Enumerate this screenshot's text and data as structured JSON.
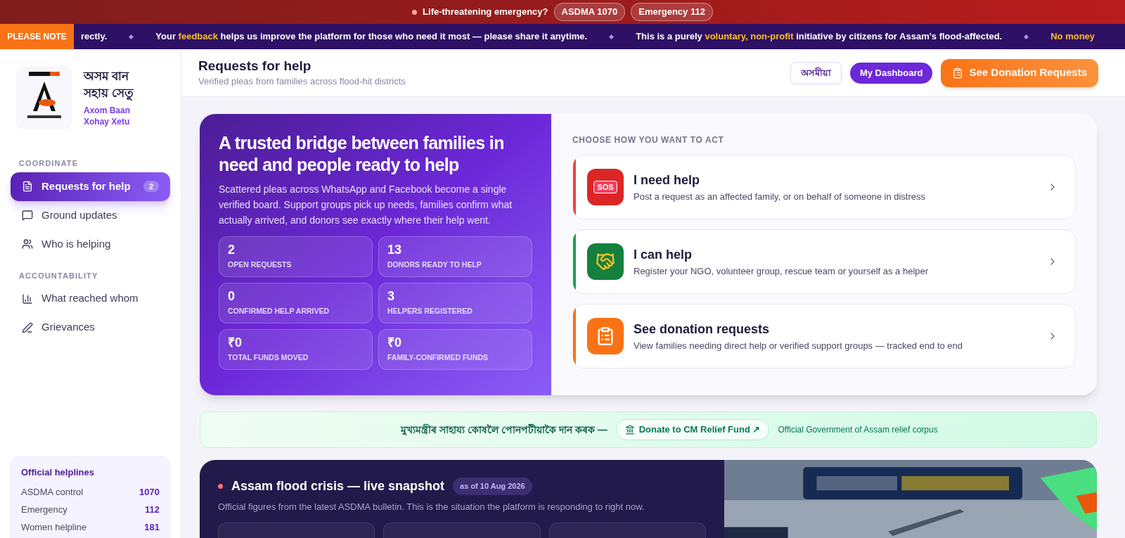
{
  "alert_bar": {
    "text": "Life-threatening emergency?",
    "pills": [
      "ASDMA 1070",
      "Emergency 112"
    ]
  },
  "ticker": {
    "badge": "PLEASE NOTE",
    "items": [
      "rectly.",
      "Your **feedback** helps us improve the platform for those who need it most — please share it anytime.",
      "This is a purely **voluntary, non-profit** initiative by citizens for Assam's flood-affected.",
      "**No money**"
    ]
  },
  "sidebar": {
    "brand": {
      "title": "অসম বান সহায় সেতু",
      "subtitle": "Axom Baan Xohay Xetu"
    },
    "sections": [
      {
        "heading": "COORDINATE",
        "items": [
          {
            "label": "Requests for help",
            "kind": "document",
            "badge": "2",
            "selected": true
          },
          {
            "label": "Ground updates",
            "kind": "chat",
            "selected": false
          },
          {
            "label": "Who is helping",
            "kind": "people",
            "selected": false
          }
        ]
      },
      {
        "heading": "ACCOUNTABILITY",
        "items": [
          {
            "label": "What reached whom",
            "kind": "bars",
            "selected": false
          },
          {
            "label": "Grievances",
            "kind": "pen",
            "selected": false
          }
        ]
      }
    ],
    "helplines": {
      "title": "Official helplines",
      "rows": [
        {
          "name": "ASDMA control",
          "number": "1070"
        },
        {
          "name": "Emergency",
          "number": "112"
        },
        {
          "name": "Women helpline",
          "number": "181"
        }
      ]
    }
  },
  "header": {
    "title": "Requests for help",
    "subtitle": "Verified pleas from families across flood-hit districts",
    "language_button": "অসমীয়া",
    "dashboard_button": "My Dashboard",
    "donation_button": "See Donation Requests"
  },
  "hero": {
    "title": "A trusted bridge between families in need and people ready to help",
    "description": "Scattered pleas across WhatsApp and Facebook become a single verified board. Support groups pick up needs, families confirm what actually arrived, and donors see exactly where their help went.",
    "stats": [
      {
        "value": "2",
        "label": "OPEN REQUESTS"
      },
      {
        "value": "13",
        "label": "DONORS READY TO HELP"
      },
      {
        "value": "0",
        "label": "CONFIRMED HELP ARRIVED"
      },
      {
        "value": "3",
        "label": "HELPERS REGISTERED"
      },
      {
        "value": "₹0",
        "label": "TOTAL FUNDS MOVED"
      },
      {
        "value": "₹0",
        "label": "FAMILY-CONFIRMED FUNDS"
      }
    ],
    "actions_heading": "CHOOSE HOW YOU WANT TO ACT",
    "actions": [
      {
        "kind": "sos",
        "title": "I need help",
        "description": "Post a request as an affected family, or on behalf of someone in distress",
        "icon_text": "SOS",
        "color": "#ef4444"
      },
      {
        "kind": "help",
        "title": "I can help",
        "description": "Register your NGO, volunteer group, rescue team or yourself as a helper",
        "color": "#16a34a"
      },
      {
        "kind": "donate",
        "title": "See donation requests",
        "description": "View families needing direct help or verified support groups — tracked end to end",
        "color": "#f97316"
      }
    ]
  },
  "relief_banner": {
    "text": "মুখ্যমন্ত্ৰীৰ সাহায্য কোষলৈ পোনপটীয়াকৈ দান কৰক —",
    "button": "Donate to CM Relief Fund ↗",
    "note": "Official Government of Assam relief corpus"
  },
  "snapshot": {
    "title": "Assam flood crisis — live snapshot",
    "date_badge": "as of 10 Aug 2026",
    "description": "Official figures from the latest ASDMA bulletin. This is the situation the platform is responding to right now."
  }
}
